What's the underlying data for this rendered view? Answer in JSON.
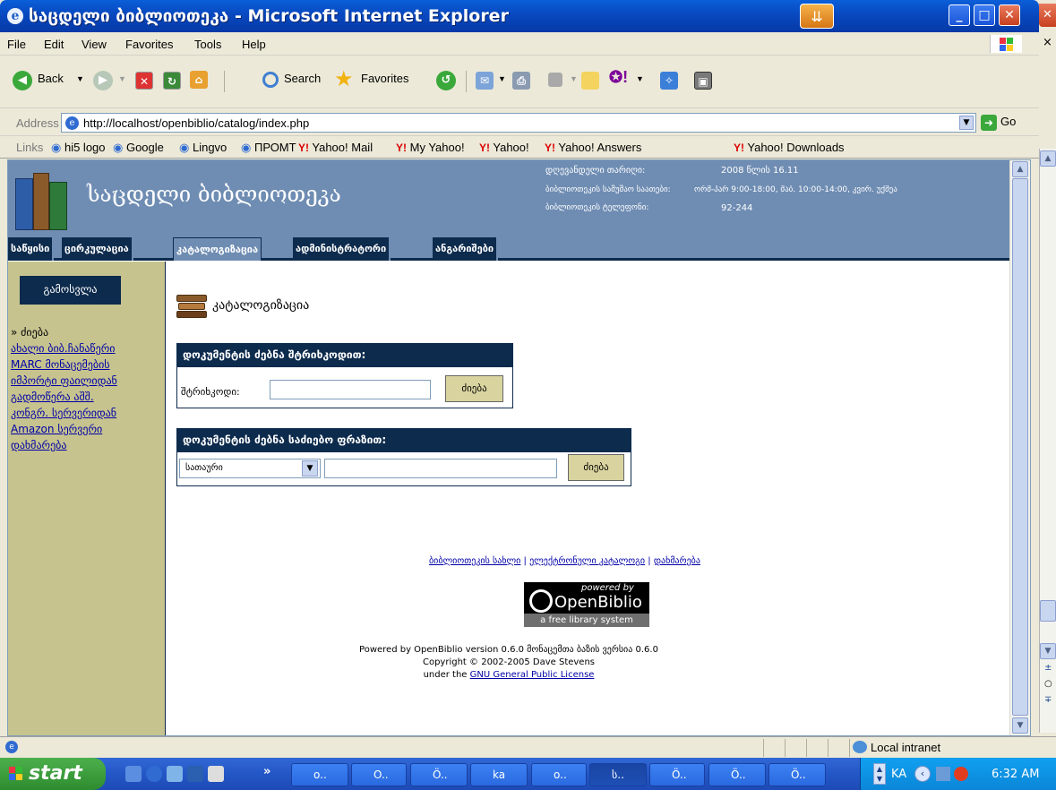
{
  "window": {
    "title": "საცდელი ბიბლიოთეკა - Microsoft Internet Explorer"
  },
  "menu": [
    "File",
    "Edit",
    "View",
    "Favorites",
    "Tools",
    "Help"
  ],
  "toolbar": {
    "back": "Back",
    "search": "Search",
    "favorites": "Favorites"
  },
  "address": {
    "label": "Address",
    "url": "http://localhost/openbiblio/catalog/index.php",
    "go": "Go"
  },
  "links": {
    "label": "Links",
    "items": [
      "hi5 logo",
      "Google",
      "Lingvo",
      "ПРОМТ",
      "Yahoo! Mail",
      "My Yahoo!",
      "Yahoo!",
      "Yahoo! Answers",
      "Yahoo! Downloads"
    ]
  },
  "page": {
    "library_name": "საცდელი ბიბლიოთეკა",
    "info": [
      {
        "label": "დღევანდელი თარიღი:",
        "value": "2008 წლის 16.11"
      },
      {
        "label": "ბიბლიოთეკის სამუშაო საათები:",
        "value": "ორშ-პარ 9:00-18:00, შაბ. 10:00-14:00, კვირ. უქმეა"
      },
      {
        "label": "ბიბლიოთეკის ტელეფონი:",
        "value": "92-244"
      }
    ],
    "tabs": [
      "საწყისი",
      "ცირკულაცია",
      "კატალოგიზაცია",
      "ადმინისტრატორი",
      "ანგარიშები"
    ],
    "logout": "გამოსვლა",
    "nav": {
      "current": "» ძიება",
      "items": [
        "ახალი ბიბ.ჩანაწერი",
        "MARC მონაცემების",
        "იმპორტი ფაილიდან",
        "გადმოწერა აშშ.",
        "კონგრ. სერვერიდან",
        "Amazon სერვერი",
        "დახმარება"
      ]
    },
    "section_title": "კატალოგიზაცია",
    "barcode_form": {
      "header": "დოკუმენტის ძებნა შტრიხკოდით:",
      "label": "შტრიხკოდი:",
      "value": "",
      "button": "ძიება"
    },
    "phrase_form": {
      "header": "დოკუმენტის ძებნა საძიებო ფრაზით:",
      "select": "სათაური",
      "value": "",
      "button": "ძიება"
    },
    "footer": {
      "links": [
        "ბიბლიოთეკის სახლი",
        "ელექტრონული კატალოგი",
        "დახმარება"
      ],
      "badge": {
        "top": "powered by",
        "name": "OpenBiblio",
        "sub": "a free library system"
      },
      "line1": "Powered by OpenBiblio version 0.6.0 მონაცემთა ბაზის ვერსია 0.6.0",
      "line2": "Copyright © 2002-2005 Dave Stevens",
      "line3_prefix": "under the",
      "line3_link": "GNU General Public License"
    }
  },
  "status": {
    "zone": "Local intranet"
  },
  "taskbar": {
    "start": "start",
    "tasks": [
      "o..",
      "O..",
      "Ö..",
      "ka",
      "o..",
      "ს..",
      "Ö..",
      "Ö..",
      "Ö.."
    ],
    "lang": "KA",
    "time": "6:32 AM"
  }
}
